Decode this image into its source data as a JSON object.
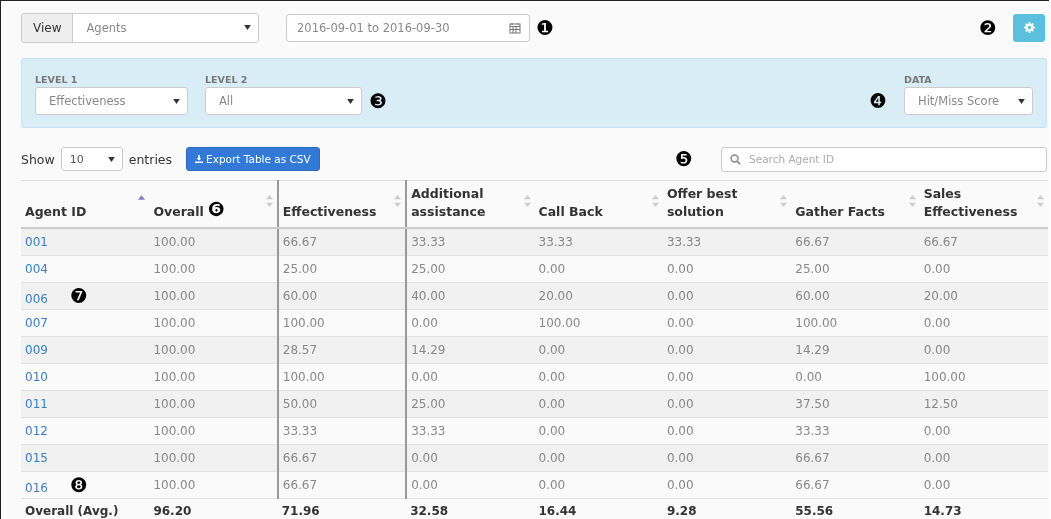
{
  "toolbar": {
    "view_label": "View",
    "view_value": "Agents",
    "date_range": "2016-09-01 to 2016-09-30",
    "date_marker": "❶",
    "settings_marker": "❷"
  },
  "filters": {
    "level1": {
      "label": "LEVEL 1",
      "value": "Effectiveness"
    },
    "level2": {
      "label": "LEVEL 2",
      "value": "All"
    },
    "level_marker": "❸",
    "data_marker": "❹",
    "data": {
      "label": "DATA",
      "value": "Hit/Miss Score"
    }
  },
  "controls": {
    "show_label": "Show",
    "page_size": "10",
    "entries_label": "entries",
    "export_button": "Export Table as CSV",
    "search_marker": "❺",
    "search_placeholder": "Search Agent ID"
  },
  "table": {
    "columns": [
      {
        "label": "Agent ID",
        "sorted": true,
        "divider_before": false
      },
      {
        "label": "Overall",
        "sorted": false,
        "divider_before": false,
        "marker": "❻"
      },
      {
        "label": "Effectiveness",
        "sorted": false,
        "divider_before": true
      },
      {
        "label": "Additional assistance",
        "sorted": false,
        "divider_before": true
      },
      {
        "label": "Call Back",
        "sorted": false,
        "divider_before": false
      },
      {
        "label": "Offer best solution",
        "sorted": false,
        "divider_before": false
      },
      {
        "label": "Gather Facts",
        "sorted": false,
        "divider_before": false
      },
      {
        "label": "Sales Effectiveness",
        "sorted": false,
        "divider_before": false
      }
    ],
    "rows": [
      {
        "cells": [
          "001",
          "100.00",
          "66.67",
          "33.33",
          "33.33",
          "33.33",
          "66.67",
          "66.67"
        ]
      },
      {
        "cells": [
          "004",
          "100.00",
          "25.00",
          "25.00",
          "0.00",
          "0.00",
          "25.00",
          "0.00"
        ]
      },
      {
        "cells": [
          "006",
          "100.00",
          "60.00",
          "40.00",
          "20.00",
          "0.00",
          "60.00",
          "20.00"
        ],
        "marker": "❼"
      },
      {
        "cells": [
          "007",
          "100.00",
          "100.00",
          "0.00",
          "100.00",
          "0.00",
          "100.00",
          "0.00"
        ]
      },
      {
        "cells": [
          "009",
          "100.00",
          "28.57",
          "14.29",
          "0.00",
          "0.00",
          "14.29",
          "0.00"
        ]
      },
      {
        "cells": [
          "010",
          "100.00",
          "100.00",
          "0.00",
          "0.00",
          "0.00",
          "0.00",
          "100.00"
        ]
      },
      {
        "cells": [
          "011",
          "100.00",
          "50.00",
          "25.00",
          "0.00",
          "0.00",
          "37.50",
          "12.50"
        ]
      },
      {
        "cells": [
          "012",
          "100.00",
          "33.33",
          "33.33",
          "0.00",
          "0.00",
          "33.33",
          "0.00"
        ]
      },
      {
        "cells": [
          "015",
          "100.00",
          "66.67",
          "0.00",
          "0.00",
          "0.00",
          "66.67",
          "0.00"
        ]
      },
      {
        "cells": [
          "016",
          "100.00",
          "66.67",
          "0.00",
          "0.00",
          "0.00",
          "66.67",
          "0.00"
        ],
        "marker": "❽"
      }
    ],
    "footer": [
      "Overall (Avg.)",
      "96.20",
      "71.96",
      "32.58",
      "16.44",
      "9.28",
      "55.56",
      "14.73"
    ]
  }
}
